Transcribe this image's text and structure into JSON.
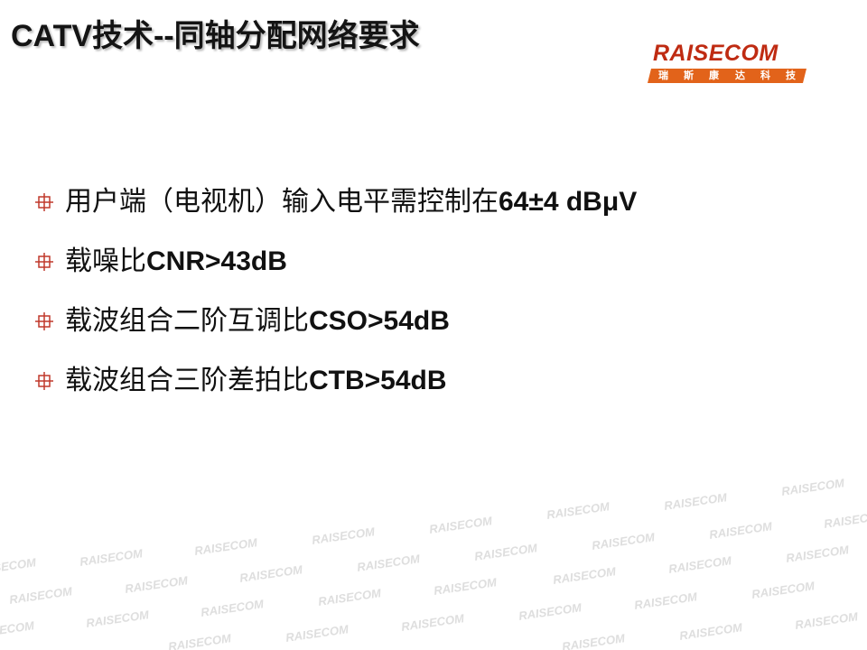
{
  "title": {
    "prefix": "CATV",
    "suffix": "技术--同轴分配网络要求"
  },
  "logo": {
    "brand": "RAISECOM",
    "chinese_chars": [
      "瑞",
      "斯",
      "康",
      "达",
      "科",
      "技"
    ],
    "brand_color": "#bf2b12",
    "band_color": "#e2631a"
  },
  "bullets": [
    {
      "icon": "cross-square-icon",
      "cn": "用户端（电视机）输入电平需控制在",
      "en": "64±4 dBμV"
    },
    {
      "icon": "cross-square-icon",
      "cn": "载噪比",
      "en": "CNR>43dB"
    },
    {
      "icon": "cross-square-icon",
      "cn": "载波组合二阶互调比",
      "en": "CSO>54dB"
    },
    {
      "icon": "cross-square-icon",
      "cn": "载波组合三阶差拍比",
      "en": "CTB>54dB"
    }
  ],
  "watermark_text": "RAISECOM",
  "colors": {
    "bullet_icon": "#c0392b",
    "watermark": "#dedede"
  }
}
